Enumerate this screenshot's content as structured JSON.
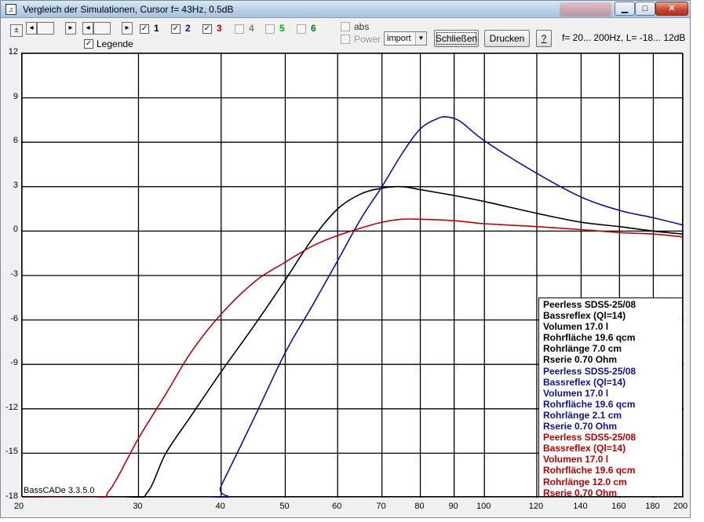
{
  "window": {
    "title": "Vergleich der Simulationen, Cursor f= 43Hz, 0.5dB",
    "app_icon": "bass-icon",
    "minimize": "▁",
    "maximize": "□",
    "close": "✕"
  },
  "toolbar": {
    "plus_label": "±",
    "curves": [
      {
        "label": "1",
        "checked": true,
        "color": "#000000"
      },
      {
        "label": "2",
        "checked": true,
        "color": "#1010a0"
      },
      {
        "label": "3",
        "checked": true,
        "color": "#c00000"
      },
      {
        "label": "4",
        "checked": false,
        "color": "#808080"
      },
      {
        "label": "5",
        "checked": false,
        "color": "#00b000"
      },
      {
        "label": "6",
        "checked": false,
        "color": "#008000"
      }
    ],
    "legende_label": "Legende",
    "abs_label": "abs",
    "power_label": "Power",
    "import_value": "import",
    "close_button": "Schließen",
    "print_button": "Drucken",
    "help_button": "?",
    "range_info": "f=  20... 200Hz, L= -18... 12dB"
  },
  "chart_data": {
    "type": "line",
    "xlabel": "",
    "ylabel": "",
    "xscale": "log",
    "xlim": [
      20,
      200
    ],
    "ylim": [
      -18,
      12
    ],
    "xticks": [
      20,
      30,
      40,
      50,
      60,
      70,
      80,
      90,
      100,
      120,
      140,
      160,
      180,
      200
    ],
    "yticks": [
      12,
      9,
      6,
      3,
      0,
      -3,
      -6,
      -9,
      -12,
      -15,
      -18
    ],
    "grid": true,
    "series": [
      {
        "color": "#000000",
        "x": [
          20,
          29,
          31,
          33,
          36,
          40,
          45,
          50,
          55,
          60,
          65,
          70,
          75,
          80,
          90,
          100,
          120,
          140,
          160,
          180,
          200
        ],
        "y": [
          -18,
          -18,
          -17.6,
          -15,
          -12.5,
          -9.5,
          -6.3,
          -3.3,
          -0.5,
          1.5,
          2.5,
          2.9,
          3.0,
          2.8,
          2.4,
          2.0,
          1.2,
          0.6,
          0.3,
          0.0,
          -0.2
        ]
      },
      {
        "color": "#1010a0",
        "x": [
          20,
          39,
          40,
          45,
          50,
          55,
          60,
          65,
          70,
          75,
          80,
          85,
          88,
          92,
          100,
          120,
          140,
          160,
          180,
          200
        ],
        "y": [
          -18,
          -18,
          -17.2,
          -12.5,
          -8.2,
          -5.0,
          -2.0,
          0.8,
          3.0,
          5.2,
          6.9,
          7.6,
          7.7,
          7.4,
          6.1,
          3.9,
          2.3,
          1.4,
          0.9,
          0.4
        ]
      },
      {
        "color": "#c00000",
        "x": [
          20,
          26,
          27,
          28,
          30,
          33,
          36,
          40,
          45,
          50,
          55,
          60,
          65,
          70,
          75,
          80,
          90,
          100,
          120,
          140,
          160,
          180,
          200
        ],
        "y": [
          -18,
          -18,
          -17.6,
          -16.5,
          -14.0,
          -11.0,
          -8.2,
          -5.6,
          -3.4,
          -2.1,
          -1.0,
          -0.3,
          0.2,
          0.6,
          0.8,
          0.8,
          0.7,
          0.5,
          0.3,
          0.1,
          -0.1,
          -0.2,
          -0.4
        ]
      }
    ]
  },
  "legend": {
    "groups": [
      {
        "color": "#000000",
        "lines": [
          "Peerless SDS5-25/08",
          "Bassreflex (Ql=14)",
          "Volumen 17.0 l",
          "Rohrfläche 19.6 qcm",
          "Rohrlänge 7.0 cm",
          "Rserie 0.70 Ohm"
        ]
      },
      {
        "color": "#1010a0",
        "lines": [
          "Peerless SDS5-25/08",
          "Bassreflex (Ql=14)",
          "Volumen 17.0 l",
          "Rohrfläche 19.6 qcm",
          "Rohrlänge 2.1 cm",
          "Rserie 0.70 Ohm"
        ]
      },
      {
        "color": "#c00000",
        "lines": [
          "Peerless SDS5-25/08",
          "Bassreflex (Ql=14)",
          "Volumen 17.0 l",
          "Rohrfläche 19.6 qcm",
          "Rohrlänge 12.0 cm",
          "Rserie 0.70 Ohm"
        ]
      }
    ]
  },
  "version": "BassCADe 3.3.5.0"
}
